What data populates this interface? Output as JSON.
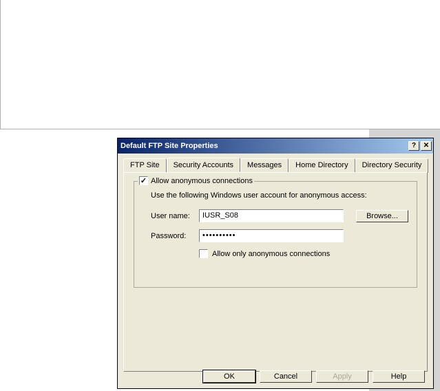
{
  "window": {
    "title": "Default FTP Site Properties"
  },
  "tabs": {
    "ftp_site": "FTP Site",
    "security_accounts": "Security Accounts",
    "messages": "Messages",
    "home_directory": "Home Directory",
    "directory_security": "Directory Security"
  },
  "panel": {
    "allow_anon_label": "Allow anonymous connections",
    "desc": "Use the following Windows user account for anonymous access:",
    "username_label": "User name:",
    "username_value": "IUSR_S08",
    "password_label": "Password:",
    "password_value": "••••••••••",
    "browse_label": "Browse...",
    "allow_only_label": "Allow only anonymous connections"
  },
  "buttons": {
    "ok": "OK",
    "cancel": "Cancel",
    "apply": "Apply",
    "help": "Help"
  },
  "titlebuttons": {
    "help": "?",
    "close": "✕"
  }
}
